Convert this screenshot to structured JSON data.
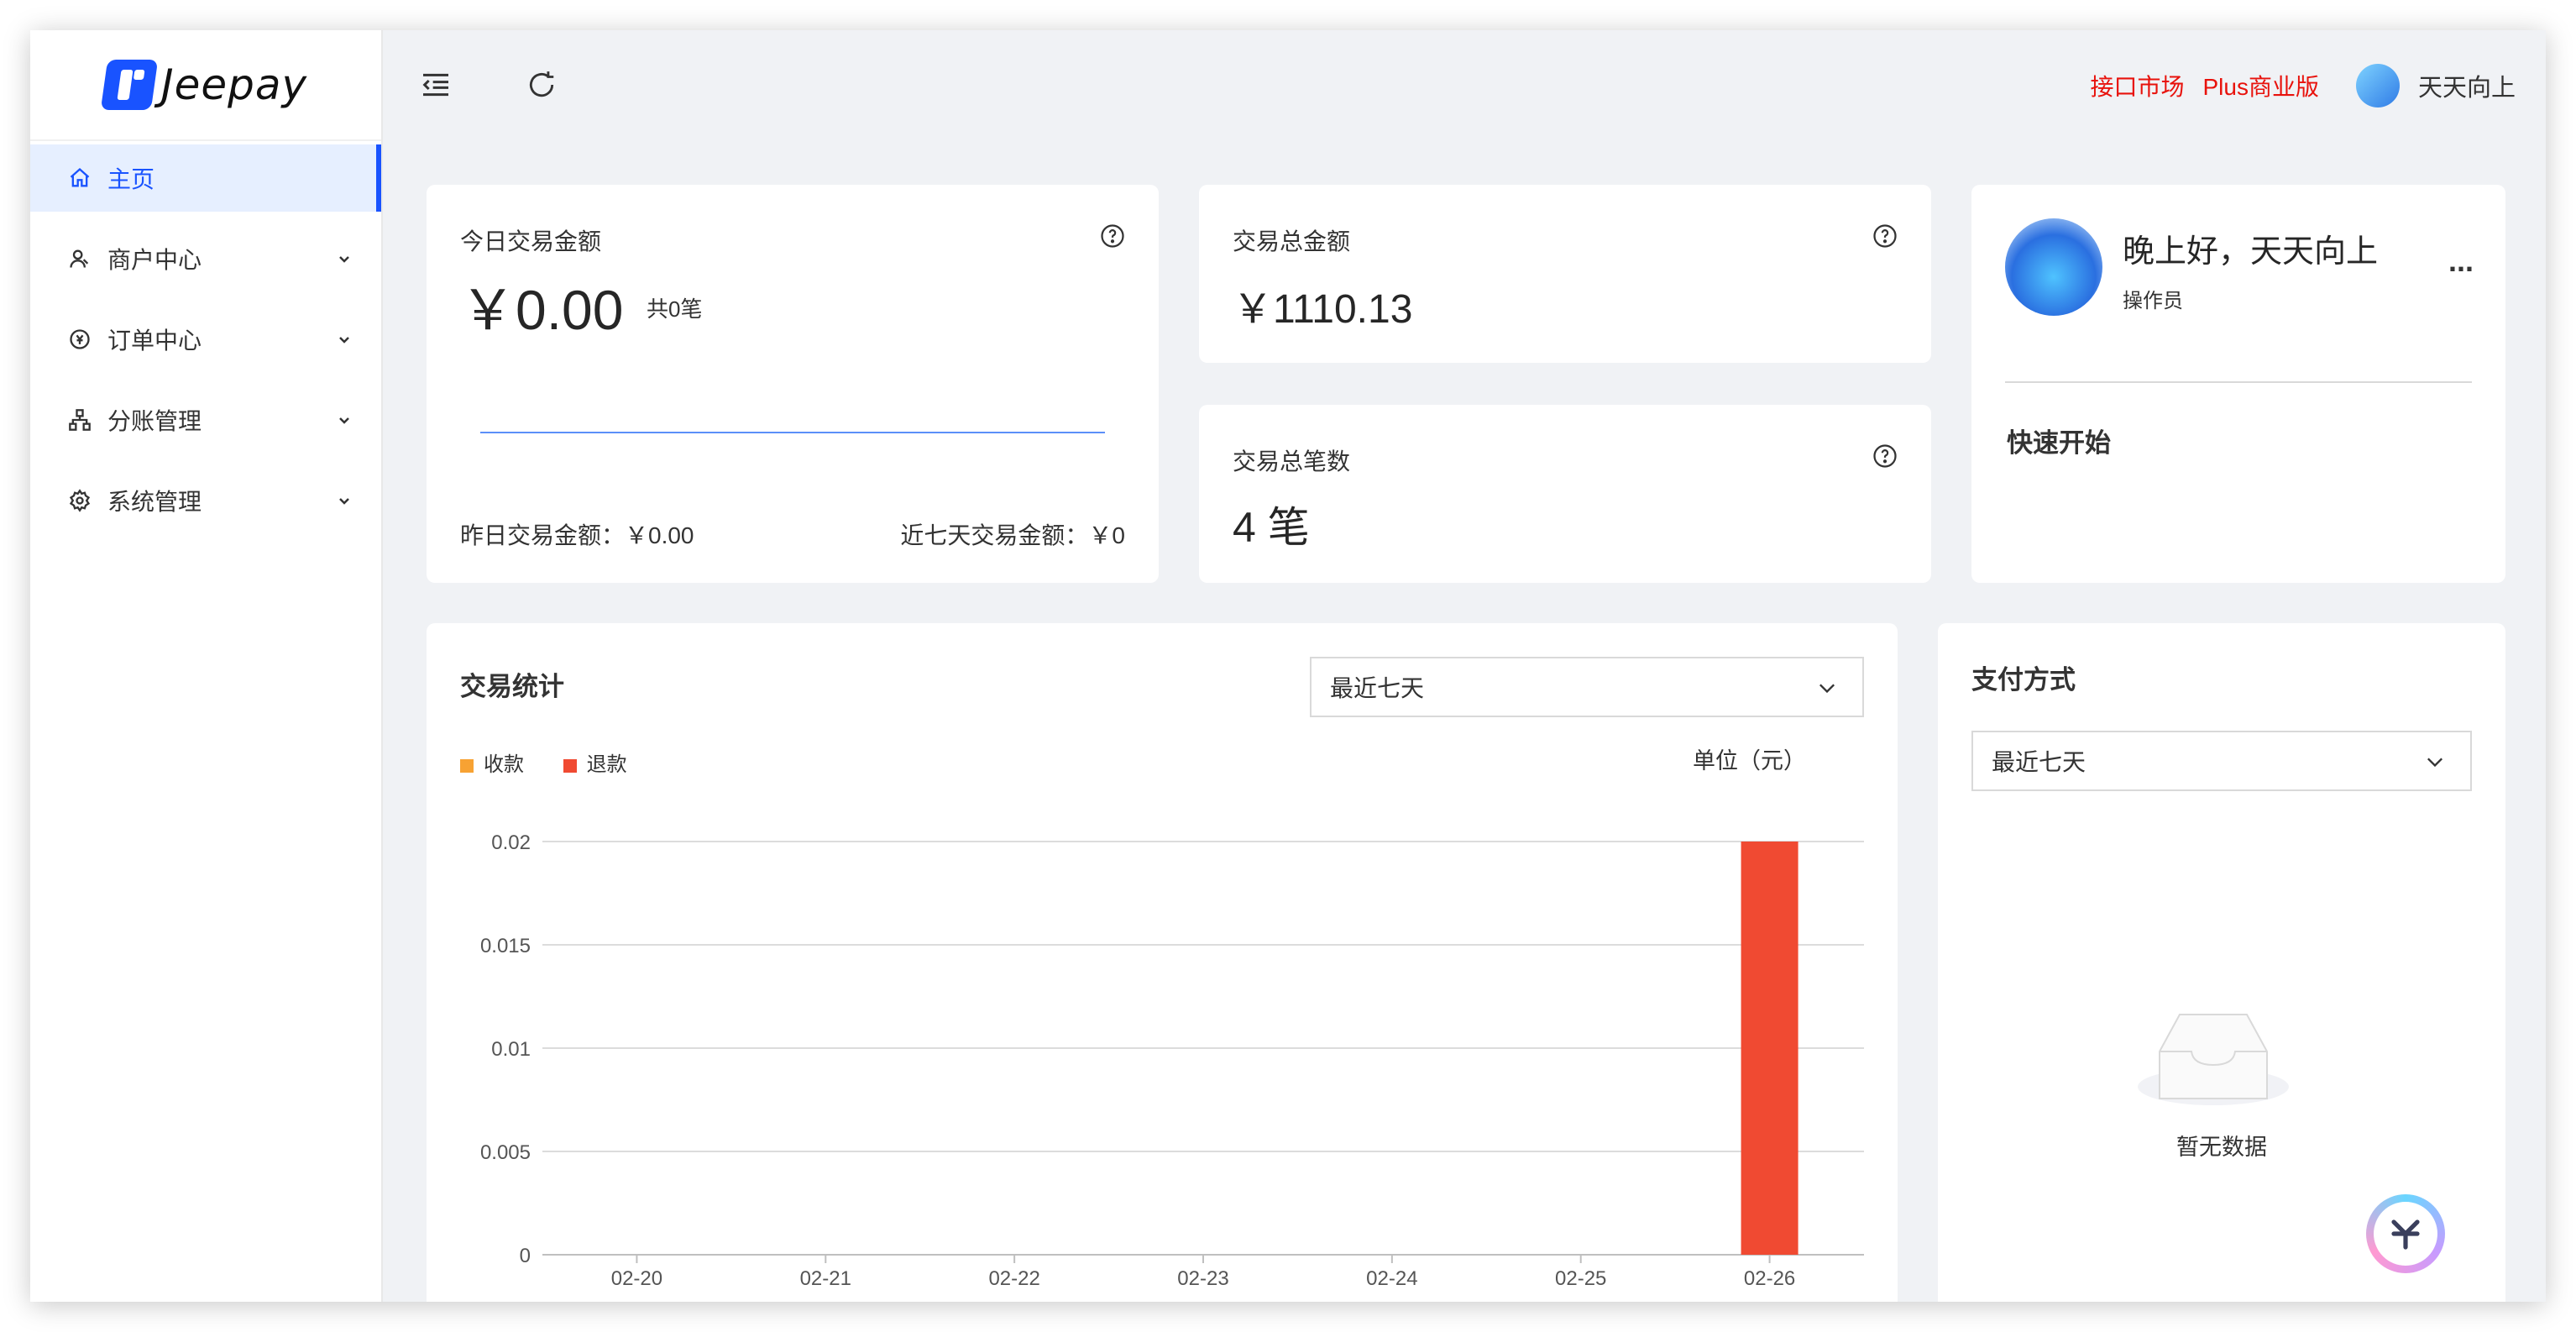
{
  "app": {
    "logo_text": "Jeepay"
  },
  "sidebar": {
    "items": [
      {
        "label": "主页",
        "icon": "home-icon",
        "active": true
      },
      {
        "label": "商户中心",
        "icon": "merchant-icon",
        "active": false
      },
      {
        "label": "订单中心",
        "icon": "order-icon",
        "active": false
      },
      {
        "label": "分账管理",
        "icon": "split-account-icon",
        "active": false
      },
      {
        "label": "系统管理",
        "icon": "settings-icon",
        "active": false
      }
    ]
  },
  "header": {
    "links": [
      "接口市场",
      "Plus商业版"
    ],
    "user_name": "天天向上",
    "colors": {
      "link": "#e8120c",
      "accent": "#1953ff"
    }
  },
  "today_card": {
    "title": "今日交易金额",
    "amount": "￥0.00",
    "count": "共0笔",
    "yesterday": "昨日交易金额：￥0.00",
    "seven_days": "近七天交易金额：￥0"
  },
  "total_amount_card": {
    "title": "交易总金额",
    "value": "￥1110.13"
  },
  "total_count_card": {
    "title": "交易总笔数",
    "value": "4 笔"
  },
  "welcome_card": {
    "greeting": "晚上好，天天向上",
    "role": "操作员",
    "more": "...",
    "quick_start": "快速开始"
  },
  "stats_card": {
    "title": "交易统计",
    "range_select": "最近七天",
    "unit": "单位（元）",
    "legend": [
      {
        "name": "收款",
        "color": "#f7a233"
      },
      {
        "name": "退款",
        "color": "#f04a32"
      }
    ]
  },
  "chart_data": {
    "type": "bar",
    "categories": [
      "02-20",
      "02-21",
      "02-22",
      "02-23",
      "02-24",
      "02-25",
      "02-26"
    ],
    "series": [
      {
        "name": "收款",
        "values": [
          0,
          0,
          0,
          0,
          0,
          0,
          0
        ]
      },
      {
        "name": "退款",
        "values": [
          0,
          0,
          0,
          0,
          0,
          0,
          0.02
        ]
      }
    ],
    "y_ticks": [
      "0",
      "0.005",
      "0.01",
      "0.015",
      "0.02"
    ],
    "ylim": [
      0,
      0.02
    ],
    "grid": true,
    "legend_position": "top-left"
  },
  "payment_card": {
    "title": "支付方式",
    "range_select": "最近七天",
    "empty_text": "暂无数据"
  }
}
